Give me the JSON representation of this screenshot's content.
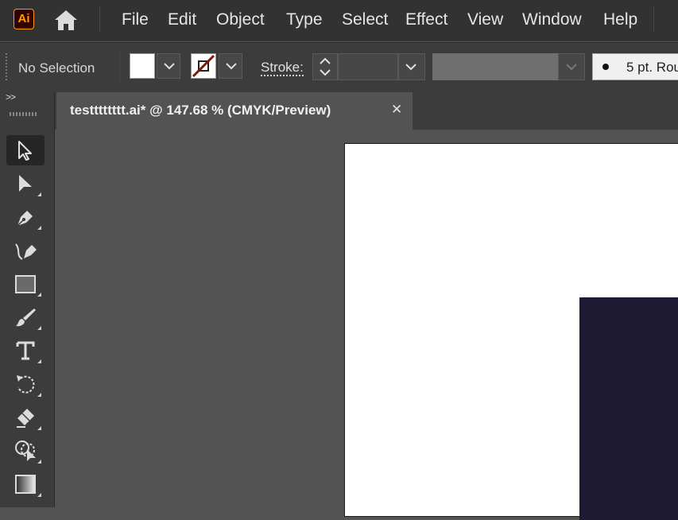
{
  "app": {
    "logo_text": "Ai",
    "brand_color": "#ff9a00",
    "logo_bg": "#330000"
  },
  "menu": {
    "items": [
      "File",
      "Edit",
      "Object",
      "Type",
      "Select",
      "Effect",
      "View",
      "Window",
      "Help"
    ]
  },
  "control_bar": {
    "selection_status": "No Selection",
    "stroke_label": "Stroke:",
    "brush_label": "5 pt. Rou"
  },
  "toolbar": {
    "collapse_label": ">>",
    "tools": [
      {
        "name": "selection-tool",
        "icon": "arrow-outline-icon",
        "active": true
      },
      {
        "name": "direct-selection-tool",
        "icon": "arrow-solid-icon"
      },
      {
        "name": "pen-tool",
        "icon": "pen-icon"
      },
      {
        "name": "curvature-tool",
        "icon": "curvature-pen-icon"
      },
      {
        "name": "rectangle-tool",
        "icon": "rectangle-icon"
      },
      {
        "name": "paintbrush-tool",
        "icon": "brush-icon"
      },
      {
        "name": "type-tool",
        "icon": "type-t-icon"
      },
      {
        "name": "rotate-tool",
        "icon": "rotate-icon"
      },
      {
        "name": "eraser-tool",
        "icon": "eraser-icon"
      },
      {
        "name": "shape-builder-tool",
        "icon": "shape-builder-icon"
      },
      {
        "name": "gradient-tool",
        "icon": "gradient-icon"
      }
    ]
  },
  "document": {
    "tab_title": "testttttttt.ai* @ 147.68 % (CMYK/Preview)",
    "close_symbol": "✕"
  },
  "colors": {
    "artboard": "#ffffff",
    "artwork_fill": "#1e1a33",
    "pasteboard": "#535353"
  }
}
